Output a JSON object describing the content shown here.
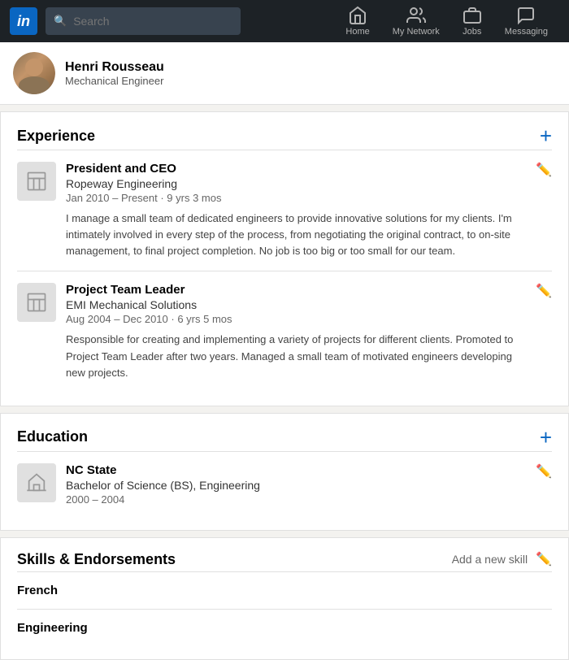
{
  "nav": {
    "logo_label": "in",
    "search_placeholder": "Search",
    "items": [
      {
        "id": "home",
        "label": "Home",
        "icon": "🏠"
      },
      {
        "id": "network",
        "label": "My Network",
        "icon": "👥"
      },
      {
        "id": "jobs",
        "label": "Jobs",
        "icon": "💼"
      },
      {
        "id": "messaging",
        "label": "Messaging",
        "icon": "💬"
      }
    ]
  },
  "profile": {
    "name": "Henri Rousseau",
    "title": "Mechanical Engineer"
  },
  "experience": {
    "section_title": "Experience",
    "add_label": "+",
    "items": [
      {
        "job_title": "President and CEO",
        "company": "Ropeway Engineering",
        "dates": "Jan 2010 – Present · 9 yrs 3 mos",
        "description": "I manage a small team of dedicated engineers to provide innovative solutions for my clients. I'm intimately involved in every step of the process, from negotiating the original contract, to on-site management, to final project completion. No job is too big or too small for our team."
      },
      {
        "job_title": "Project Team Leader",
        "company": "EMI Mechanical Solutions",
        "dates": "Aug 2004 – Dec 2010 · 6 yrs 5 mos",
        "description": "Responsible for creating and implementing a variety of projects for different clients. Promoted to Project Team Leader after two years. Managed a small team of motivated engineers developing new projects."
      }
    ]
  },
  "education": {
    "section_title": "Education",
    "add_label": "+",
    "items": [
      {
        "school": "NC State",
        "degree": "Bachelor of Science (BS), Engineering",
        "dates": "2000 – 2004"
      }
    ]
  },
  "skills": {
    "section_title": "Skills & Endorsements",
    "add_skill_label": "Add a new skill",
    "items": [
      {
        "name": "French"
      },
      {
        "name": "Engineering"
      }
    ]
  }
}
